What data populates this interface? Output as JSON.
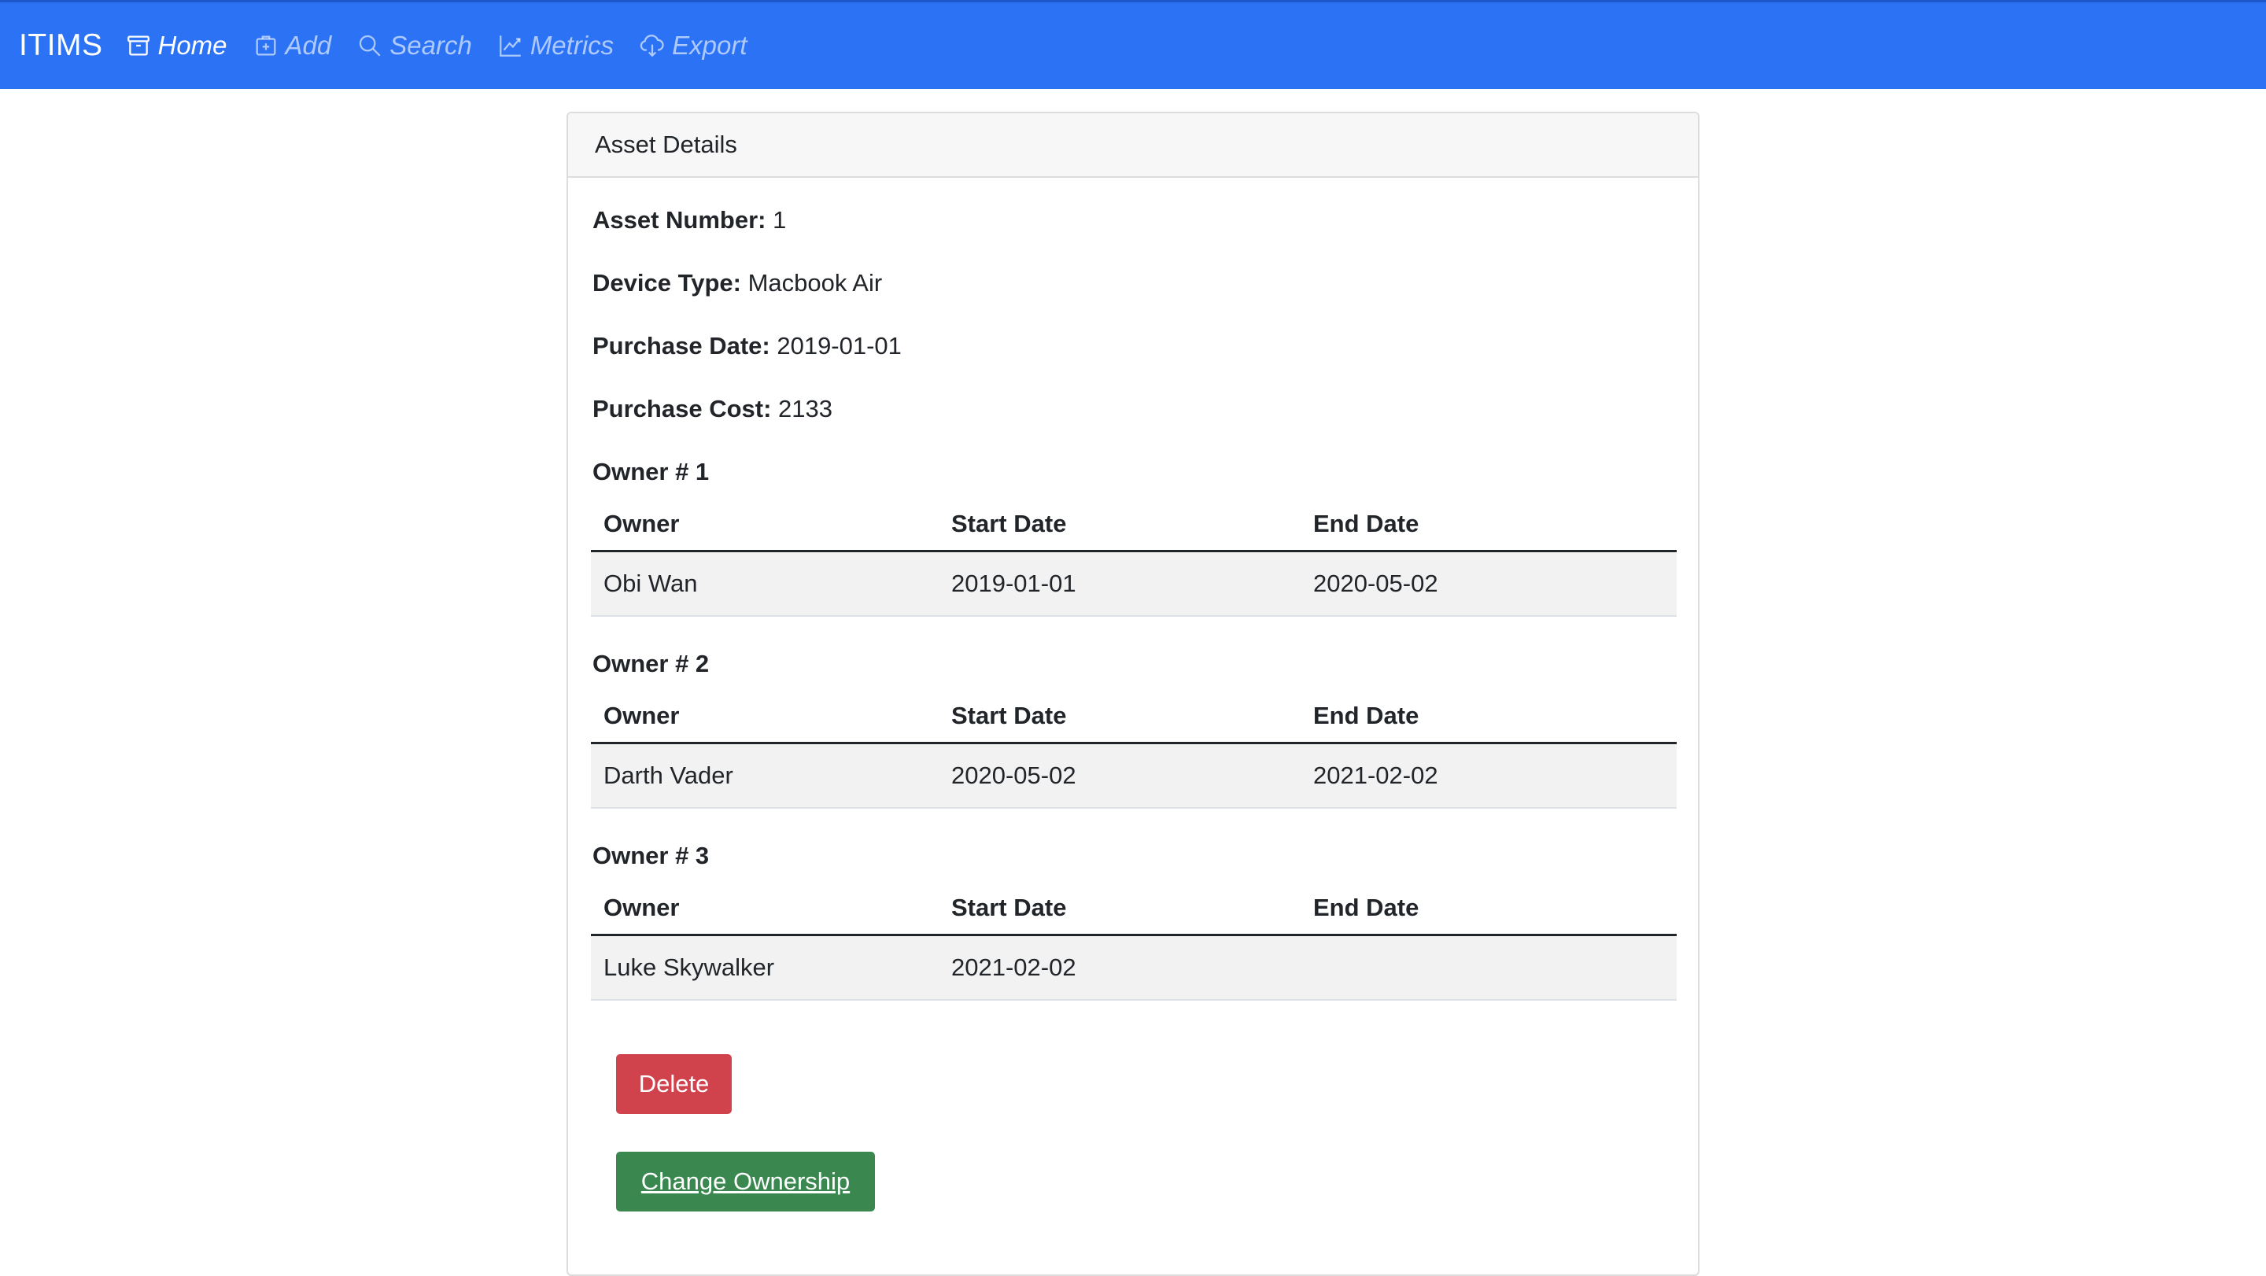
{
  "app": {
    "brand": "ITIMS",
    "accent_color": "#2b72f5"
  },
  "nav": {
    "items": [
      {
        "label": "Home",
        "icon": "archive-icon",
        "active": true
      },
      {
        "label": "Add",
        "icon": "plus-box-icon",
        "active": false
      },
      {
        "label": "Search",
        "icon": "search-icon",
        "active": false
      },
      {
        "label": "Metrics",
        "icon": "line-chart-icon",
        "active": false
      },
      {
        "label": "Export",
        "icon": "cloud-download-icon",
        "active": false
      }
    ]
  },
  "card": {
    "title": "Asset Details"
  },
  "asset": {
    "number_label": "Asset Number:",
    "number_value": "1",
    "device_type_label": "Device Type:",
    "device_type_value": "Macbook Air",
    "purchase_date_label": "Purchase Date:",
    "purchase_date_value": "2019-01-01",
    "purchase_cost_label": "Purchase Cost:",
    "purchase_cost_value": "2133"
  },
  "table_headers": {
    "owner": "Owner",
    "start_date": "Start Date",
    "end_date": "End Date"
  },
  "owners": [
    {
      "title": "Owner # 1",
      "owner": "Obi Wan",
      "start_date": "2019-01-01",
      "end_date": "2020-05-02"
    },
    {
      "title": "Owner # 2",
      "owner": "Darth Vader",
      "start_date": "2020-05-02",
      "end_date": "2021-02-02"
    },
    {
      "title": "Owner # 3",
      "owner": "Luke Skywalker",
      "start_date": "2021-02-02",
      "end_date": ""
    }
  ],
  "actions": {
    "delete_label": "Delete",
    "delete_color": "#d0434d",
    "change_ownership_label": "Change Ownership",
    "change_ownership_color": "#3b8750"
  }
}
